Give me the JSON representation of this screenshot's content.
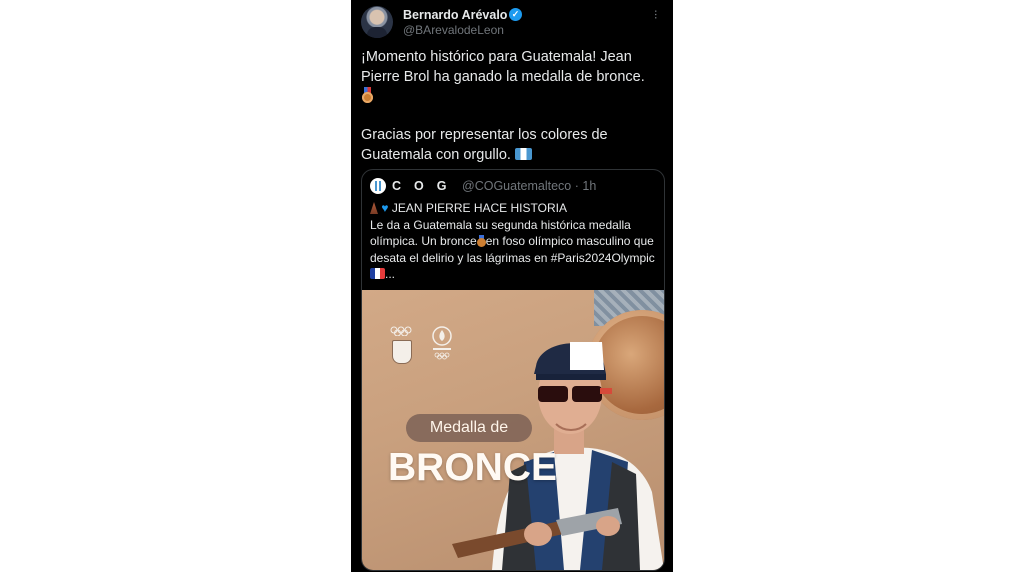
{
  "tweet": {
    "author_name": "Bernardo Arévalo",
    "author_handle": "@BArevalodeLeon",
    "verified_mark": "✓",
    "more_icon": "···",
    "text_line1": "¡Momento histórico para Guatemala! Jean Pierre Brol ha ganado la medalla de bronce.",
    "text_line2": "Gracias por representar los colores de Guatemala con orgullo."
  },
  "quoted": {
    "name": "COG",
    "handle": "@COGuatemalteco · 1h",
    "headline": "JEAN PIERRE HACE HISTORIA",
    "body_part1": "Le da a Guatemala su segunda histórica medalla olímpica. Un bronce",
    "body_part2": "en foso olímpico masculino que desata el delirio y las lágrimas en #Paris2024Olympic",
    "body_ellipsis": "...",
    "media": {
      "pill_text": "Medalla de",
      "big_text": "BRONCE"
    }
  },
  "colors": {
    "background": "#000000",
    "text": "#e7e9ea",
    "muted": "#71767b",
    "verified": "#1d9bf0",
    "bronze": "#cd7f32"
  }
}
